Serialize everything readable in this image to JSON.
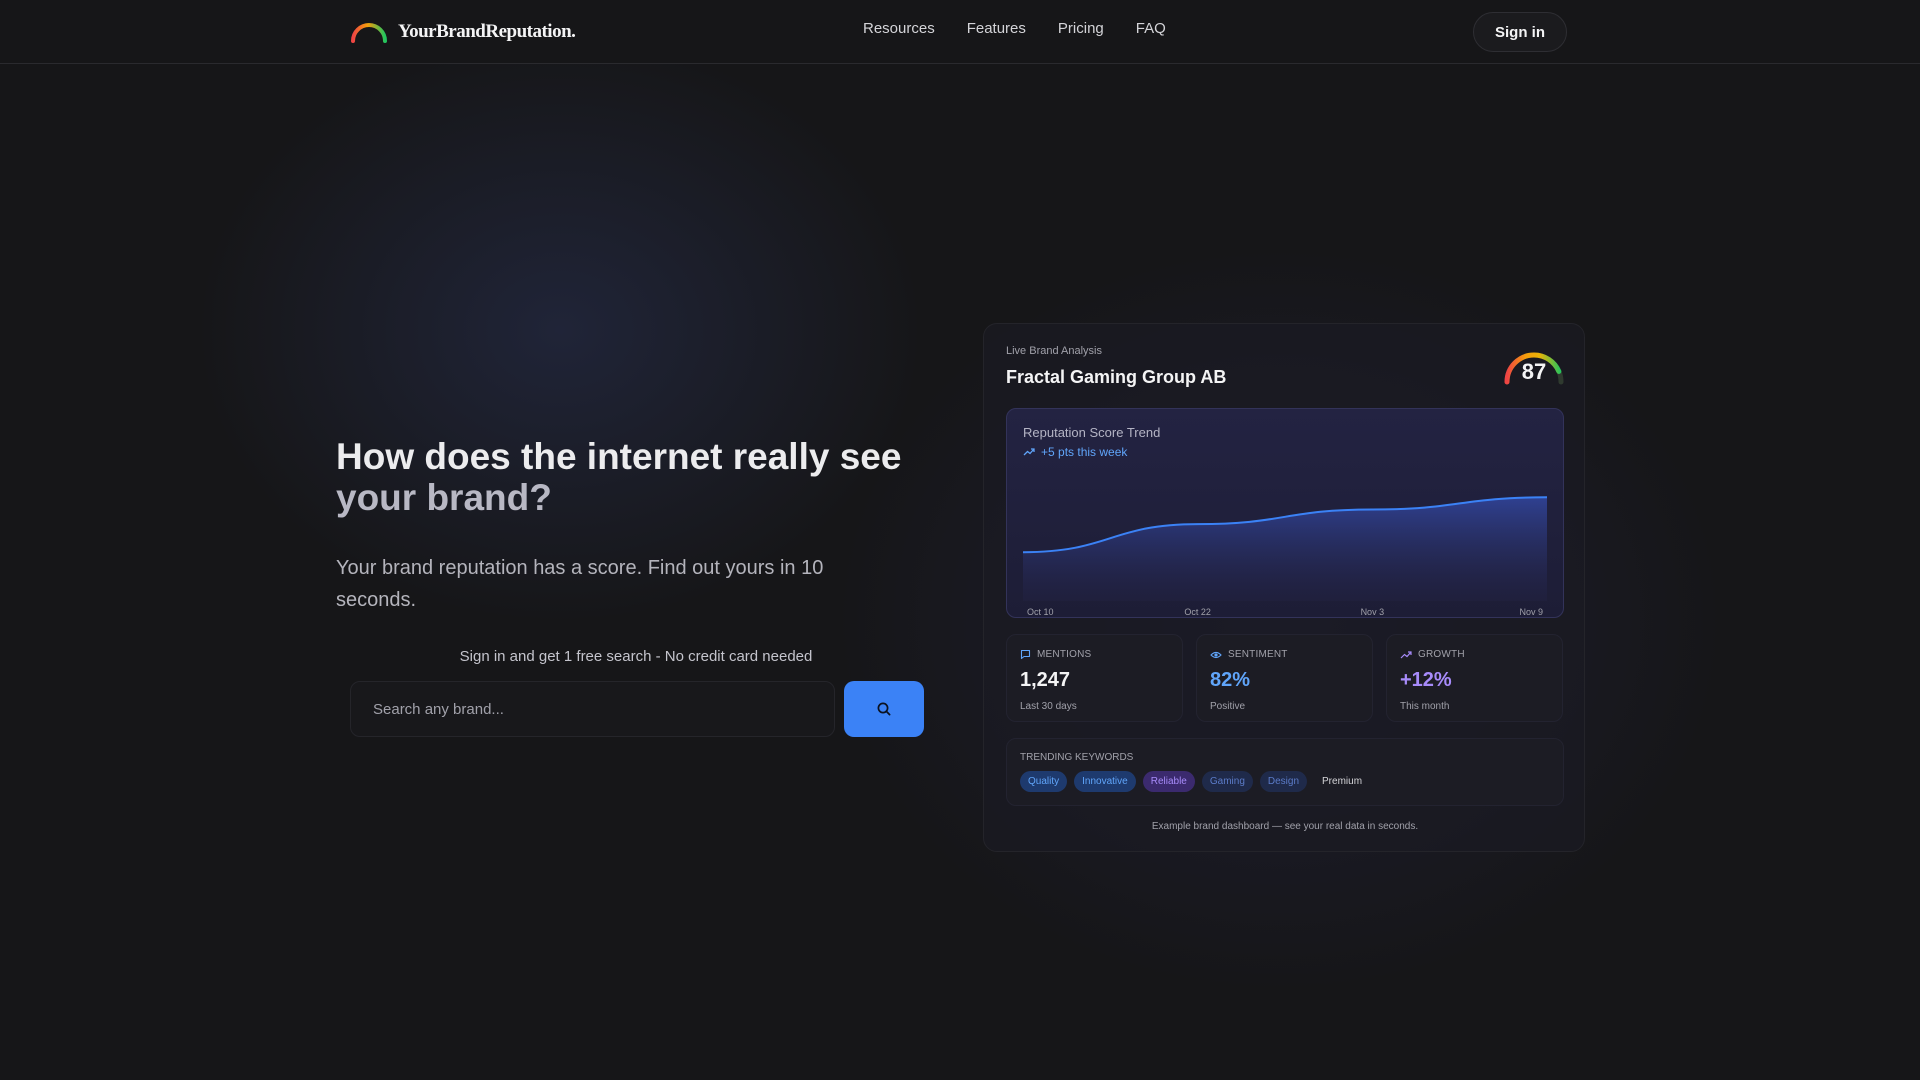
{
  "nav": {
    "brand": "YourBrandReputation.",
    "links": [
      "Resources",
      "Features",
      "Pricing",
      "FAQ"
    ],
    "signin_label": "Sign in"
  },
  "hero": {
    "title_line1": "How does the internet really see",
    "title_line2": "your brand?",
    "subtitle": "Your brand reputation has a score. Find out yours in 10 seconds.",
    "free_note": "Sign in and get 1 free search - No credit card needed",
    "search_placeholder": "Search any brand..."
  },
  "dashboard": {
    "eyebrow": "Live Brand Analysis",
    "brand_name": "Fractal Gaming Group AB",
    "score": "87",
    "score_value": 87,
    "trend_title": "Reputation Score Trend",
    "trend_delta": "+5 pts this week",
    "stats": [
      {
        "icon": "chat-bubble-icon",
        "label": "MENTIONS",
        "value": "1,247",
        "caption": "Last 30 days",
        "color": "#f4f4f5"
      },
      {
        "icon": "eye-icon",
        "label": "SENTIMENT",
        "value": "82%",
        "caption": "Positive",
        "color": "#60a5fa"
      },
      {
        "icon": "trending-up-icon",
        "label": "GROWTH",
        "value": "+12%",
        "caption": "This month",
        "color": "#a78bfa"
      }
    ],
    "keywords_title": "TRENDING KEYWORDS",
    "keywords": [
      {
        "label": "Quality",
        "bg": "#1e3a6e",
        "fg": "#60a5fa"
      },
      {
        "label": "Innovative",
        "bg": "#1e3a6e",
        "fg": "#60a5fa"
      },
      {
        "label": "Reliable",
        "bg": "#3b2a6e",
        "fg": "#a78bfa"
      },
      {
        "label": "Gaming",
        "bg": "#1f2a4a",
        "fg": "#5b7bc8"
      },
      {
        "label": "Design",
        "bg": "#1f2a4a",
        "fg": "#5b7bc8"
      },
      {
        "label": "Premium",
        "bg": "transparent",
        "fg": "#d4d4d8"
      }
    ],
    "footnote": "Example brand dashboard — see your real data in seconds."
  },
  "chart_data": {
    "type": "area",
    "title": "Reputation Score Trend",
    "x": [
      "Oct 10",
      "Oct 22",
      "Nov 3",
      "Nov 9"
    ],
    "x_ticks": [
      "Oct 10",
      "Oct 22",
      "Nov 3",
      "Nov 9"
    ],
    "series": [
      {
        "values": [
          40,
          63,
          75,
          85
        ]
      }
    ],
    "ylim": [
      0,
      100
    ],
    "grid": false,
    "color": "#3b82f6"
  }
}
